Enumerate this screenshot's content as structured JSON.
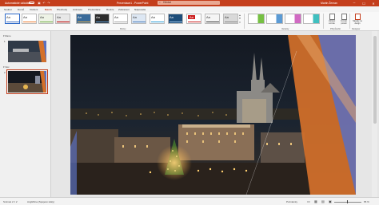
{
  "titlebar": {
    "autosave": "Automatické ukládání",
    "document": "Prezentace1 - PowerPoint",
    "search_placeholder": "Hledat",
    "user": "Martin Žeman",
    "save_icon": "save-icon",
    "undo_icon": "undo-icon",
    "redo_icon": "redo-icon",
    "minimize": "─",
    "maximize": "☐",
    "close": "✕"
  },
  "tabs": [
    "Soubor",
    "Domů",
    "Vložení",
    "Návrh",
    "Přechody",
    "Animace",
    "Prezentace",
    "Revize",
    "Zobrazení",
    "Nápověda"
  ],
  "active_tab": "Návrh",
  "ribbon": {
    "themes": [
      "Aa",
      "Aa",
      "Aa",
      "Aa",
      "Aa",
      "Aa",
      "Aa",
      "Aa",
      "Aa",
      "Aa",
      "Aa",
      "Aa",
      "Aa"
    ],
    "theme_colors": [
      "#ffffff",
      "#4472c4",
      "#e7e6e6",
      "#ed7d31",
      "#3a6b9a",
      "#e8b04b",
      "#ffffff",
      "#4a7ebb",
      "#2a9bd6",
      "#1d4d7a",
      "#cc1f1f",
      "#333333",
      "#888888"
    ],
    "group_themes": "Motivy",
    "group_variants": "Varianty",
    "group_customize": "Přizpůsobit",
    "group_designer": "Designer",
    "slide_size": "Velikost snímku",
    "format_background": "Formát pozadí",
    "design_ideas": "Nápady na design"
  },
  "slide_pane": {
    "section1": "Rano",
    "section2": "Noc",
    "slide_numbers": [
      "1",
      "2"
    ]
  },
  "status": {
    "slide_info": "Snímek 2 z 2",
    "language": "Angličtina (Spojené státy)",
    "notes": "Poznámky",
    "zoom": "65 %"
  }
}
